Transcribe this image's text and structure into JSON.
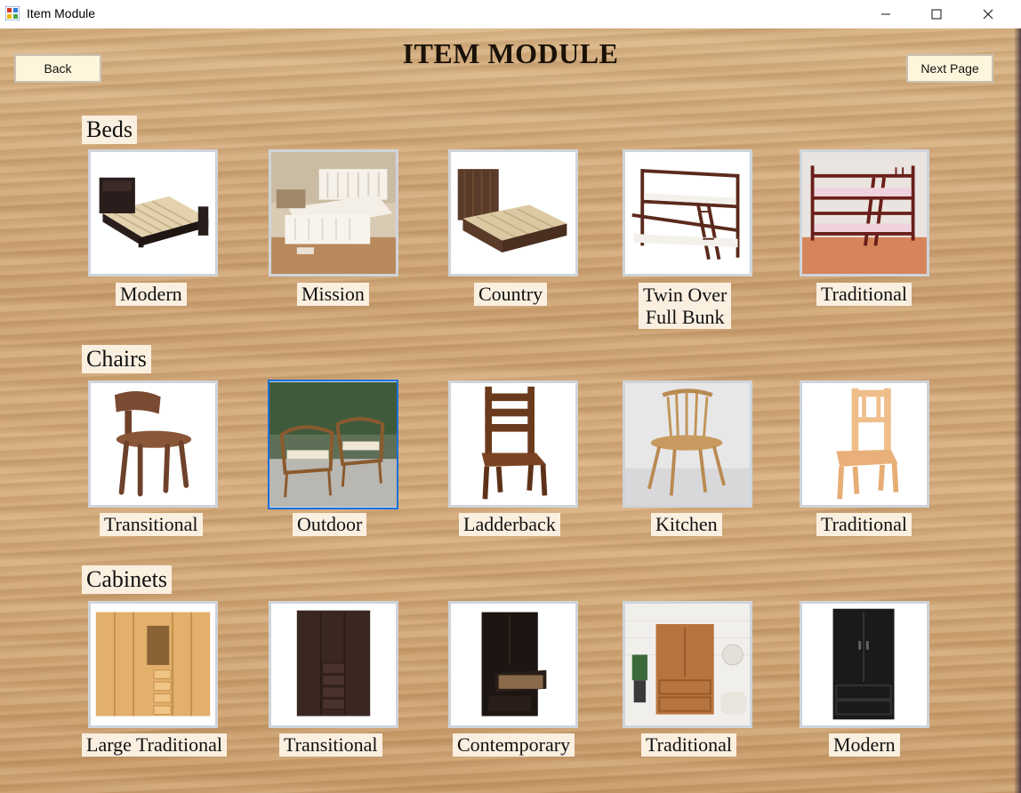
{
  "window": {
    "title": "Item Module",
    "controls": {
      "minimize": "minimize-icon",
      "maximize": "maximize-icon",
      "close": "close-icon"
    }
  },
  "header": {
    "title": "ITEM MODULE",
    "back_label": "Back",
    "next_label": "Next Page"
  },
  "sections": [
    {
      "label": "Beds",
      "items": [
        {
          "label": "Modern",
          "image": "modern-bed-image"
        },
        {
          "label": "Mission",
          "image": "mission-bed-image"
        },
        {
          "label": "Country",
          "image": "country-bed-image"
        },
        {
          "label_line1": "Twin Over",
          "label_line2": "Full Bunk",
          "image": "twin-over-full-bunk-bed-image"
        },
        {
          "label": "Traditional",
          "image": "traditional-bunk-bed-image"
        }
      ]
    },
    {
      "label": "Chairs",
      "items": [
        {
          "label": "Transitional",
          "image": "transitional-chair-image"
        },
        {
          "label": "Outdoor",
          "image": "outdoor-chair-image"
        },
        {
          "label": "Ladderback",
          "image": "ladderback-chair-image"
        },
        {
          "label": "Kitchen",
          "image": "kitchen-chair-image"
        },
        {
          "label": "Traditional",
          "image": "traditional-chair-image"
        }
      ]
    },
    {
      "label": "Cabinets",
      "items": [
        {
          "label": "Large Traditional",
          "image": "large-traditional-cabinet-image"
        },
        {
          "label": "Transitional",
          "image": "transitional-cabinet-image"
        },
        {
          "label": "Contemporary",
          "image": "contemporary-cabinet-image"
        },
        {
          "label": "Traditional",
          "image": "traditional-cabinet-image"
        },
        {
          "label": "Modern",
          "image": "modern-cabinet-image"
        }
      ]
    }
  ],
  "colors": {
    "caption_bg": "#fbefe0",
    "button_bg": "#fdf6dd",
    "selection_border": "#1e6fd9",
    "wood_background": "#d2ab7b"
  }
}
